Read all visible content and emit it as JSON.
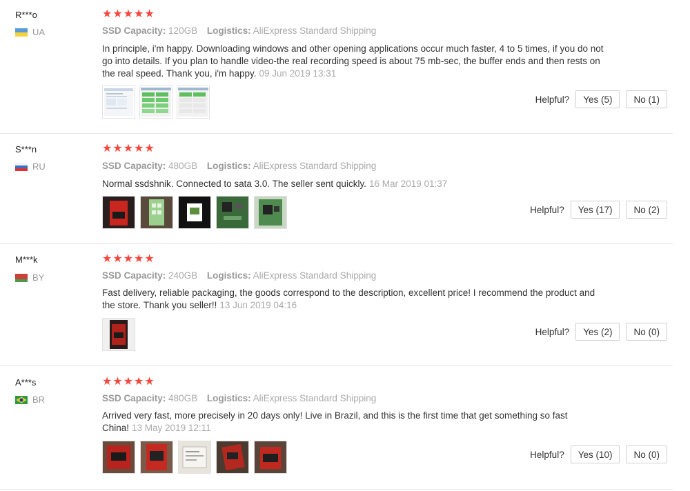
{
  "labels": {
    "ssd_capacity": "SSD Capacity:",
    "logistics": "Logistics:",
    "helpful": "Helpful?",
    "stars": "★★★★★"
  },
  "reviews": [
    {
      "user": "R***o",
      "country": "UA",
      "flag_colors": [
        "#5b9bd5",
        "#f3d23a"
      ],
      "rating": 5,
      "ssd_capacity": "120GB",
      "logistics": "AliExpress Standard Shipping",
      "text": "In principle, i'm happy. Downloading windows and other opening applications occur much faster, 4 to 5 times, if you do not go into details. If you plan to handle video-the real recording speed is about 75 mb-sec, the buffer ends and then rests on the real speed. Thank you, i'm happy.",
      "date": "09 Jun 2019 13:31",
      "photo_count": 3,
      "yes": "Yes (5)",
      "no": "No (1)"
    },
    {
      "user": "S***n",
      "country": "RU",
      "flag_colors": [
        "#ffffff",
        "#3a6fc4",
        "#d9343a"
      ],
      "rating": 5,
      "ssd_capacity": "480GB",
      "logistics": "AliExpress Standard Shipping",
      "text": "Normal ssdshnik. Connected to sata 3.0. The seller sent quickly.",
      "date": "16 Mar 2019 01:37",
      "photo_count": 5,
      "yes": "Yes (17)",
      "no": "No (2)"
    },
    {
      "user": "M***k",
      "country": "BY",
      "flag_colors": [
        "#c8413b",
        "#4a9a4a"
      ],
      "rating": 5,
      "ssd_capacity": "240GB",
      "logistics": "AliExpress Standard Shipping",
      "text": "Fast delivery, reliable packaging, the goods correspond to the description, excellent price! I recommend the product and the store. Thank you seller!!",
      "date": "13 Jun 2019 04:16",
      "photo_count": 1,
      "yes": "Yes (2)",
      "no": "No (0)"
    },
    {
      "user": "A***s",
      "country": "BR",
      "flag_colors": [
        "#2e9a45",
        "#f5d232",
        "#233e8b"
      ],
      "rating": 5,
      "ssd_capacity": "480GB",
      "logistics": "AliExpress Standard Shipping",
      "text": "Arrived very fast, more precisely in 20 days only! Live in Brazil, and this is the first time that get something so fast China!",
      "date": "13 May 2019 12:11",
      "photo_count": 5,
      "yes": "Yes (10)",
      "no": "No (0)"
    }
  ]
}
